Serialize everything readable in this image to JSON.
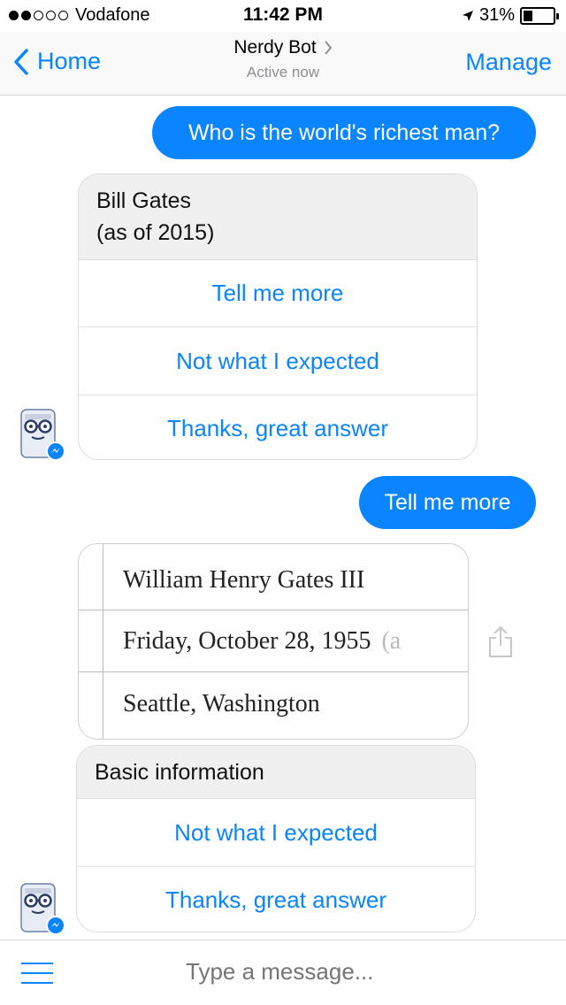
{
  "status_bar": {
    "carrier": "Vodafone",
    "time": "11:42 PM",
    "battery": "31%",
    "battery_level": 0.31
  },
  "nav": {
    "back_label": "Home",
    "title": "Nerdy Bot",
    "subtitle": "Active now",
    "manage_label": "Manage"
  },
  "messages": {
    "user_1": "Who is the world's richest man?",
    "bot_1": {
      "header_line1": "Bill Gates",
      "header_line2": "(as of 2015)",
      "buttons": [
        "Tell me more",
        "Not what I expected",
        "Thanks, great answer"
      ]
    },
    "user_2": "Tell me more",
    "image_table": {
      "rows": [
        "William Henry Gates III",
        "Friday, October 28, 1955",
        "Seattle, Washington"
      ],
      "row2_suffix": "(a"
    },
    "bot_2": {
      "header": "Basic information",
      "buttons": [
        "Not what I expected",
        "Thanks, great answer"
      ]
    }
  },
  "composer": {
    "placeholder": "Type a message..."
  },
  "colors": {
    "accent": "#0a84ff",
    "card_header": "#f0f0f0"
  }
}
